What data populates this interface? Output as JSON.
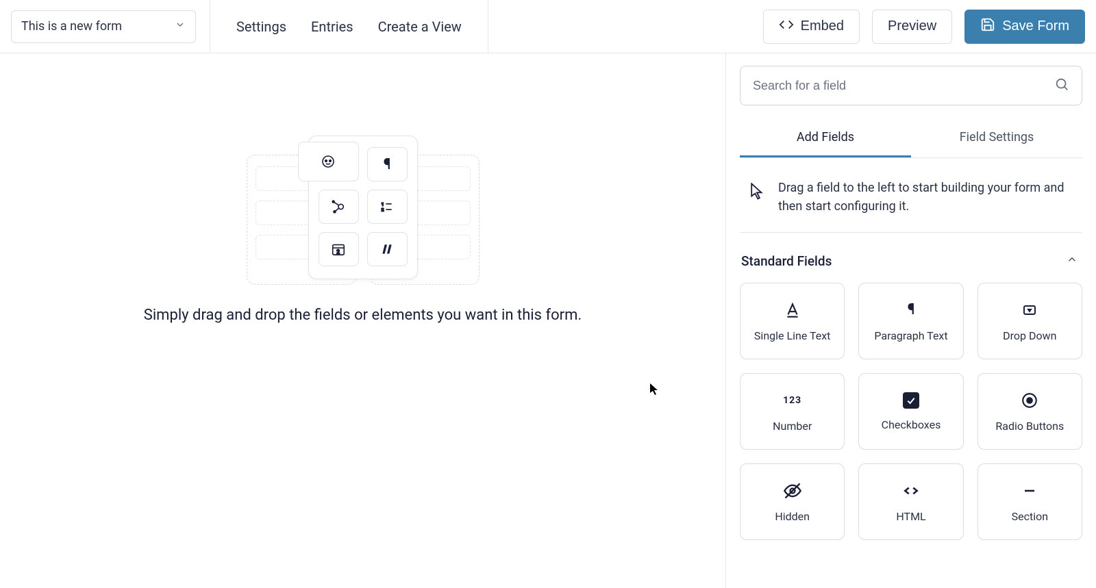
{
  "header": {
    "form_title": "This is a new form",
    "links": {
      "settings": "Settings",
      "entries": "Entries",
      "create_view": "Create a View"
    },
    "actions": {
      "embed": "Embed",
      "preview": "Preview",
      "save": "Save Form"
    }
  },
  "canvas": {
    "hint": "Simply drag and drop the fields or elements you want in this form."
  },
  "sidebar": {
    "search_placeholder": "Search for a field",
    "tabs": {
      "add": "Add Fields",
      "settings": "Field Settings"
    },
    "hint": "Drag a field to the left to start building your form and then start configuring it.",
    "section_title": "Standard Fields",
    "fields": {
      "single_line": "Single Line Text",
      "paragraph": "Paragraph Text",
      "dropdown": "Drop Down",
      "number": "Number",
      "checkboxes": "Checkboxes",
      "radio": "Radio Buttons",
      "hidden": "Hidden",
      "html": "HTML",
      "section": "Section"
    }
  }
}
